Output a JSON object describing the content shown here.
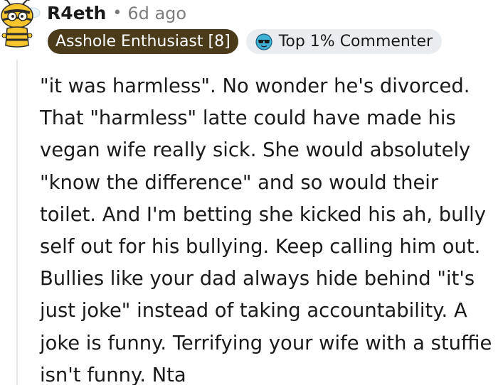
{
  "comment": {
    "author": "R4eth",
    "separator": "•",
    "age": "6d ago",
    "user_flair": "Asshole Enthusiast [8]",
    "achievement_flair": {
      "label": "Top 1% Commenter",
      "icon": "sunglasses-icon"
    },
    "body_lines": [
      "\"it was harmless\". No wonder he's divorced.",
      "That \"harmless\" latte could have made his",
      "vegan wife really sick. She would absolutely",
      "\"know the difference\" and so would their",
      "toilet. And I'm betting she kicked his ah, bully",
      "self out for his bullying. Keep calling him out.",
      "Bullies like your dad always hide behind \"it's",
      "just joke\" instead of taking accountability. A",
      "joke is funny. Terrifying your wife with a stuffie",
      "isn't funny. Nta"
    ],
    "colors": {
      "user_flair_bg": "#4b3b1b",
      "achievement_flair_bg": "#eaedef",
      "meta_text": "#7c7c7c",
      "thread_line": "#e5e7e9"
    }
  }
}
